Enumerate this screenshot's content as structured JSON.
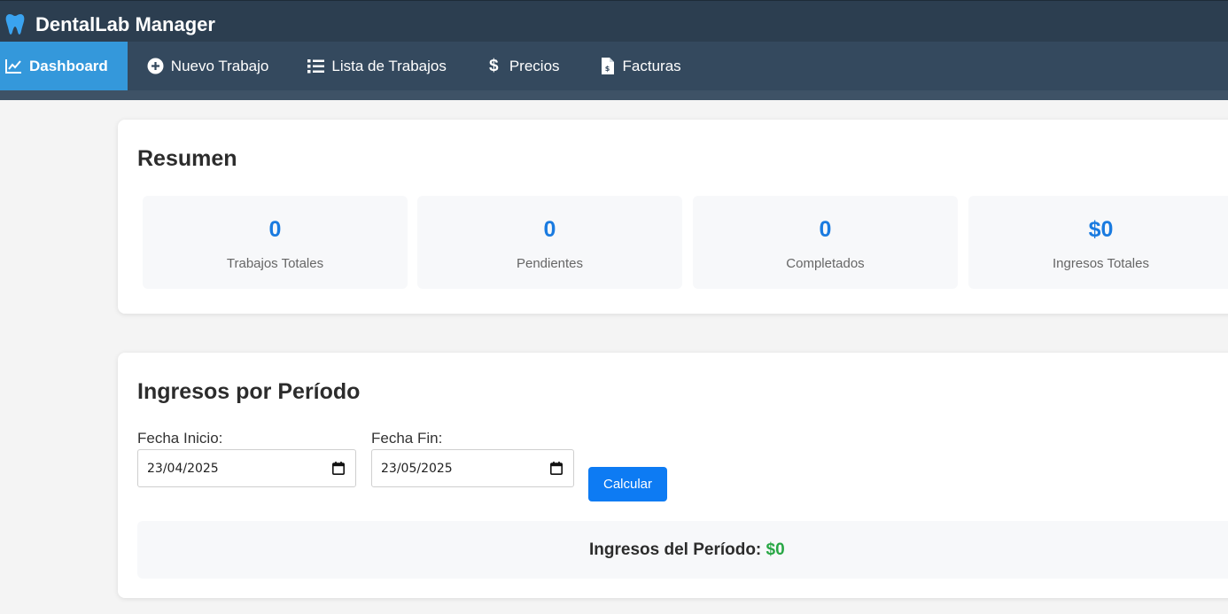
{
  "app": {
    "title": "DentalLab Manager",
    "logo_icon": "tooth-icon",
    "colors": {
      "header": "#2c3e50",
      "nav": "#34495e",
      "active_nav": "#3498db",
      "accent_blue": "#1a7be0",
      "button": "#0d7bf3",
      "success": "#28a745"
    }
  },
  "nav": {
    "items": [
      {
        "label": "Dashboard",
        "icon": "chart-line-icon",
        "active": true
      },
      {
        "label": "Nuevo Trabajo",
        "icon": "plus-circle-icon",
        "active": false
      },
      {
        "label": "Lista de Trabajos",
        "icon": "list-icon",
        "active": false
      },
      {
        "label": "Precios",
        "icon": "dollar-icon",
        "active": false
      },
      {
        "label": "Facturas",
        "icon": "invoice-icon",
        "active": false
      }
    ]
  },
  "summary": {
    "title": "Resumen",
    "stats": [
      {
        "value": "0",
        "label": "Trabajos Totales"
      },
      {
        "value": "0",
        "label": "Pendientes"
      },
      {
        "value": "0",
        "label": "Completados"
      },
      {
        "value": "$0",
        "label": "Ingresos Totales"
      }
    ]
  },
  "income": {
    "title": "Ingresos por Período",
    "start_label": "Fecha Inicio:",
    "start_value": "23/04/2025",
    "end_label": "Fecha Fin:",
    "end_value": "23/05/2025",
    "calculate_label": "Calcular",
    "result_label": "Ingresos del Período:",
    "result_value": "$0"
  }
}
